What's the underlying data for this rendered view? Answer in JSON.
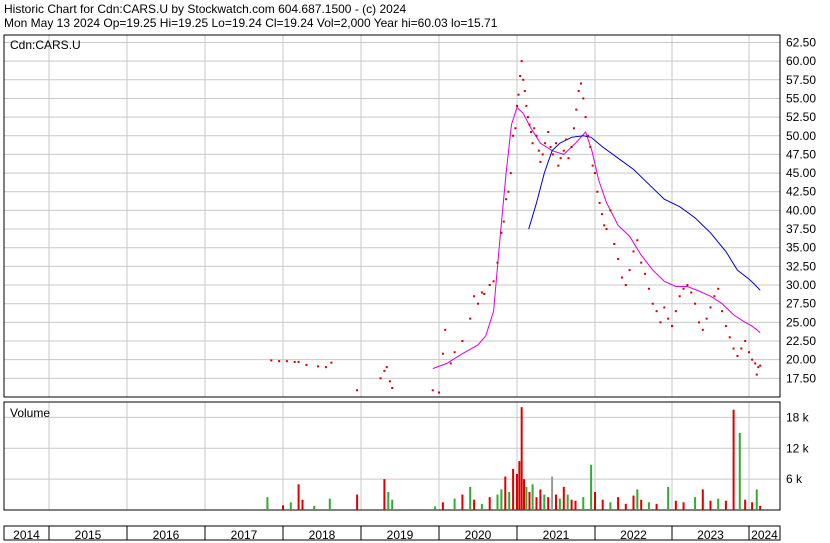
{
  "header": {
    "line1": "Historic Chart for Cdn:CARS.U by Stockwatch.com 604.687.1500 - (c) 2024",
    "line2": "Mon May 13 2024   Op=19.25   Hi=19.25   Lo=19.24   Cl=19.24   Vol=2,000   Year hi=60.03   lo=15.71"
  },
  "chart_data": [
    {
      "type": "scatter",
      "title": "Cdn:CARS.U",
      "ylim": [
        15,
        63.5
      ],
      "y_ticks": [
        62.5,
        60,
        57.5,
        55,
        52.5,
        50,
        47.5,
        45,
        42.5,
        40,
        37.5,
        35,
        32.5,
        30,
        27.5,
        25,
        22.5,
        20,
        17.5
      ],
      "x_categories": [
        "2014",
        "2015",
        "2016",
        "2017",
        "2018",
        "2019",
        "2020",
        "2021",
        "2022",
        "2023",
        "2024"
      ],
      "grid": true,
      "series": [
        {
          "color": "#cc0000",
          "style": "points",
          "points": [
            [
              2017.85,
              19.9
            ],
            [
              2017.95,
              19.8
            ],
            [
              2018.05,
              19.8
            ],
            [
              2018.15,
              19.7
            ],
            [
              2018.2,
              19.7
            ],
            [
              2018.3,
              19.3
            ],
            [
              2018.45,
              19.1
            ],
            [
              2018.55,
              19.0
            ],
            [
              2018.62,
              19.6
            ],
            [
              2018.95,
              15.9
            ],
            [
              2019.25,
              17.5
            ],
            [
              2019.3,
              18.5
            ],
            [
              2019.33,
              19.0
            ],
            [
              2019.37,
              17.1
            ],
            [
              2019.4,
              16.2
            ],
            [
              2019.92,
              15.9
            ],
            [
              2020.0,
              15.6
            ],
            [
              2020.05,
              20.8
            ],
            [
              2020.08,
              24.0
            ],
            [
              2020.15,
              19.5
            ],
            [
              2020.2,
              21.0
            ],
            [
              2020.3,
              22.5
            ],
            [
              2020.4,
              25.5
            ],
            [
              2020.45,
              28.5
            ],
            [
              2020.5,
              27.5
            ],
            [
              2020.55,
              29.0
            ],
            [
              2020.58,
              28.8
            ],
            [
              2020.65,
              30.0
            ],
            [
              2020.7,
              30.5
            ],
            [
              2020.75,
              33.0
            ],
            [
              2020.8,
              37.0
            ],
            [
              2020.83,
              38.5
            ],
            [
              2020.86,
              41.5
            ],
            [
              2020.89,
              42.5
            ],
            [
              2020.92,
              45.0
            ],
            [
              2020.95,
              50.0
            ],
            [
              2020.98,
              51.0
            ],
            [
              2021.0,
              54.0
            ],
            [
              2021.02,
              55.5
            ],
            [
              2021.04,
              58.0
            ],
            [
              2021.06,
              60.0
            ],
            [
              2021.08,
              57.5
            ],
            [
              2021.1,
              56.0
            ],
            [
              2021.12,
              54.0
            ],
            [
              2021.14,
              52.5
            ],
            [
              2021.16,
              51.5
            ],
            [
              2021.18,
              50.5
            ],
            [
              2021.2,
              49.0
            ],
            [
              2021.22,
              51.0
            ],
            [
              2021.25,
              50.0
            ],
            [
              2021.28,
              48.0
            ],
            [
              2021.3,
              46.5
            ],
            [
              2021.33,
              47.5
            ],
            [
              2021.36,
              49.0
            ],
            [
              2021.4,
              50.5
            ],
            [
              2021.43,
              48.5
            ],
            [
              2021.46,
              47.5
            ],
            [
              2021.5,
              49.0
            ],
            [
              2021.53,
              46.0
            ],
            [
              2021.56,
              47.0
            ],
            [
              2021.6,
              48.0
            ],
            [
              2021.63,
              49.5
            ],
            [
              2021.66,
              47.0
            ],
            [
              2021.7,
              48.5
            ],
            [
              2021.73,
              51.0
            ],
            [
              2021.76,
              53.5
            ],
            [
              2021.79,
              56.0
            ],
            [
              2021.82,
              57.0
            ],
            [
              2021.85,
              55.0
            ],
            [
              2021.88,
              52.5
            ],
            [
              2021.91,
              50.0
            ],
            [
              2021.94,
              48.5
            ],
            [
              2021.97,
              46.0
            ],
            [
              2022.0,
              45.0
            ],
            [
              2022.03,
              42.5
            ],
            [
              2022.06,
              41.0
            ],
            [
              2022.09,
              39.5
            ],
            [
              2022.12,
              38.0
            ],
            [
              2022.15,
              37.5
            ],
            [
              2022.2,
              40.0
            ],
            [
              2022.25,
              35.5
            ],
            [
              2022.3,
              33.5
            ],
            [
              2022.35,
              31.0
            ],
            [
              2022.4,
              30.0
            ],
            [
              2022.45,
              32.0
            ],
            [
              2022.5,
              34.5
            ],
            [
              2022.55,
              36.0
            ],
            [
              2022.6,
              33.0
            ],
            [
              2022.65,
              31.5
            ],
            [
              2022.7,
              29.5
            ],
            [
              2022.75,
              27.5
            ],
            [
              2022.8,
              26.5
            ],
            [
              2022.85,
              25.0
            ],
            [
              2022.9,
              27.0
            ],
            [
              2022.95,
              25.5
            ],
            [
              2023.0,
              24.5
            ],
            [
              2023.05,
              26.5
            ],
            [
              2023.1,
              28.5
            ],
            [
              2023.15,
              29.5
            ],
            [
              2023.2,
              30.0
            ],
            [
              2023.25,
              29.0
            ],
            [
              2023.3,
              27.5
            ],
            [
              2023.35,
              25.0
            ],
            [
              2023.4,
              24.0
            ],
            [
              2023.45,
              25.5
            ],
            [
              2023.5,
              27.0
            ],
            [
              2023.55,
              28.5
            ],
            [
              2023.6,
              29.5
            ],
            [
              2023.65,
              26.5
            ],
            [
              2023.7,
              24.5
            ],
            [
              2023.75,
              23.0
            ],
            [
              2023.8,
              21.5
            ],
            [
              2023.85,
              20.5
            ],
            [
              2023.9,
              21.5
            ],
            [
              2023.95,
              22.5
            ],
            [
              2024.0,
              21.0
            ],
            [
              2024.1,
              20.0
            ],
            [
              2024.2,
              19.5
            ],
            [
              2024.25,
              18.0
            ],
            [
              2024.3,
              19.0
            ],
            [
              2024.36,
              19.2
            ]
          ]
        },
        {
          "color": "#dd00dd",
          "style": "line",
          "points": [
            [
              2019.92,
              18.8
            ],
            [
              2020.1,
              19.5
            ],
            [
              2020.3,
              20.8
            ],
            [
              2020.5,
              22.0
            ],
            [
              2020.6,
              23.2
            ],
            [
              2020.7,
              26.5
            ],
            [
              2020.78,
              36.0
            ],
            [
              2020.86,
              45.0
            ],
            [
              2020.93,
              51.5
            ],
            [
              2021.0,
              53.8
            ],
            [
              2021.08,
              53.0
            ],
            [
              2021.18,
              51.0
            ],
            [
              2021.3,
              49.0
            ],
            [
              2021.45,
              48.0
            ],
            [
              2021.6,
              47.5
            ],
            [
              2021.75,
              49.0
            ],
            [
              2021.88,
              50.5
            ],
            [
              2021.96,
              48.0
            ],
            [
              2022.05,
              44.0
            ],
            [
              2022.15,
              41.0
            ],
            [
              2022.3,
              38.0
            ],
            [
              2022.45,
              36.5
            ],
            [
              2022.6,
              34.0
            ],
            [
              2022.75,
              32.0
            ],
            [
              2022.9,
              30.5
            ],
            [
              2023.05,
              29.8
            ],
            [
              2023.2,
              29.8
            ],
            [
              2023.35,
              29.2
            ],
            [
              2023.5,
              28.5
            ],
            [
              2023.65,
              27.5
            ],
            [
              2023.8,
              26.0
            ],
            [
              2023.95,
              25.0
            ],
            [
              2024.1,
              24.5
            ],
            [
              2024.25,
              24.0
            ],
            [
              2024.36,
              23.6
            ]
          ]
        },
        {
          "color": "#0000cc",
          "style": "line",
          "points": [
            [
              2021.15,
              37.5
            ],
            [
              2021.25,
              41.0
            ],
            [
              2021.35,
              45.0
            ],
            [
              2021.45,
              48.0
            ],
            [
              2021.55,
              49.0
            ],
            [
              2021.7,
              49.8
            ],
            [
              2021.85,
              50.0
            ],
            [
              2021.95,
              49.8
            ],
            [
              2022.1,
              48.5
            ],
            [
              2022.3,
              47.0
            ],
            [
              2022.5,
              45.5
            ],
            [
              2022.7,
              43.5
            ],
            [
              2022.9,
              41.5
            ],
            [
              2023.1,
              40.5
            ],
            [
              2023.3,
              39.0
            ],
            [
              2023.5,
              37.0
            ],
            [
              2023.7,
              34.5
            ],
            [
              2023.85,
              32.0
            ],
            [
              2024.0,
              30.8
            ],
            [
              2024.15,
              30.2
            ],
            [
              2024.36,
              29.3
            ]
          ]
        }
      ]
    },
    {
      "type": "bar",
      "title": "Volume",
      "ylim": [
        0,
        21000
      ],
      "y_ticks": [
        18000,
        12000,
        6000
      ],
      "y_tick_labels": [
        "18 k",
        "12 k",
        "6 k"
      ],
      "bars": [
        [
          2017.8,
          2500,
          "green"
        ],
        [
          2018.0,
          900,
          "red"
        ],
        [
          2018.1,
          1500,
          "green"
        ],
        [
          2018.2,
          5000,
          "red"
        ],
        [
          2018.25,
          2000,
          "red"
        ],
        [
          2018.4,
          800,
          "green"
        ],
        [
          2018.6,
          2200,
          "green"
        ],
        [
          2018.95,
          3000,
          "red"
        ],
        [
          2019.3,
          6000,
          "red"
        ],
        [
          2019.35,
          3500,
          "green"
        ],
        [
          2019.4,
          2000,
          "green"
        ],
        [
          2019.95,
          700,
          "green"
        ],
        [
          2020.05,
          1500,
          "red"
        ],
        [
          2020.2,
          2200,
          "green"
        ],
        [
          2020.3,
          3000,
          "red"
        ],
        [
          2020.4,
          4500,
          "green"
        ],
        [
          2020.45,
          2000,
          "red"
        ],
        [
          2020.55,
          1200,
          "green"
        ],
        [
          2020.65,
          2500,
          "red"
        ],
        [
          2020.75,
          3000,
          "green"
        ],
        [
          2020.8,
          4000,
          "green"
        ],
        [
          2020.85,
          6500,
          "red"
        ],
        [
          2020.9,
          3500,
          "green"
        ],
        [
          2020.95,
          8000,
          "red"
        ],
        [
          2021.0,
          7000,
          "red"
        ],
        [
          2021.03,
          9500,
          "red"
        ],
        [
          2021.06,
          20000,
          "red"
        ],
        [
          2021.09,
          6000,
          "red"
        ],
        [
          2021.12,
          4500,
          "green"
        ],
        [
          2021.16,
          3500,
          "red"
        ],
        [
          2021.2,
          5000,
          "green"
        ],
        [
          2021.25,
          2500,
          "red"
        ],
        [
          2021.3,
          4000,
          "red"
        ],
        [
          2021.35,
          3000,
          "green"
        ],
        [
          2021.4,
          2500,
          "red"
        ],
        [
          2021.45,
          6500,
          "gray"
        ],
        [
          2021.5,
          3000,
          "red"
        ],
        [
          2021.55,
          2200,
          "green"
        ],
        [
          2021.6,
          4500,
          "red"
        ],
        [
          2021.65,
          3000,
          "green"
        ],
        [
          2021.7,
          2000,
          "red"
        ],
        [
          2021.75,
          1800,
          "red"
        ],
        [
          2021.85,
          2500,
          "green"
        ],
        [
          2021.95,
          8800,
          "green"
        ],
        [
          2022.0,
          3500,
          "red"
        ],
        [
          2022.1,
          2000,
          "red"
        ],
        [
          2022.2,
          1500,
          "green"
        ],
        [
          2022.3,
          2500,
          "red"
        ],
        [
          2022.4,
          1200,
          "red"
        ],
        [
          2022.5,
          2800,
          "red"
        ],
        [
          2022.55,
          4000,
          "green"
        ],
        [
          2022.6,
          2000,
          "red"
        ],
        [
          2022.7,
          1500,
          "green"
        ],
        [
          2022.8,
          1200,
          "red"
        ],
        [
          2022.95,
          4500,
          "green"
        ],
        [
          2023.05,
          1800,
          "red"
        ],
        [
          2023.15,
          1500,
          "red"
        ],
        [
          2023.3,
          2500,
          "green"
        ],
        [
          2023.4,
          4000,
          "red"
        ],
        [
          2023.5,
          1800,
          "red"
        ],
        [
          2023.6,
          2200,
          "green"
        ],
        [
          2023.7,
          1800,
          "red"
        ],
        [
          2023.8,
          19500,
          "red"
        ],
        [
          2023.88,
          15000,
          "green"
        ],
        [
          2023.95,
          2000,
          "red"
        ],
        [
          2024.1,
          1500,
          "red"
        ],
        [
          2024.25,
          4000,
          "green"
        ],
        [
          2024.36,
          800,
          "red"
        ]
      ]
    }
  ]
}
